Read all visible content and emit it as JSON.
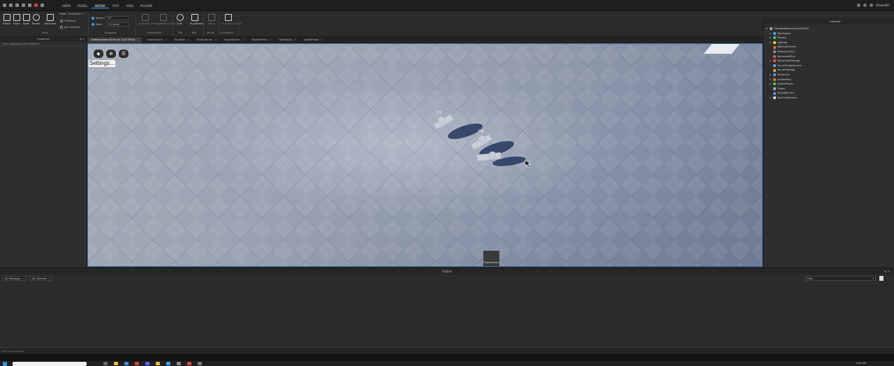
{
  "titlebar": {
    "menus": [
      "HOME",
      "MODEL",
      "AVATAR",
      "TEST",
      "VIEW",
      "PLUGINS"
    ],
    "active_menu": "AVATAR",
    "username": "ellowell07"
  },
  "ribbon": {
    "tools": [
      "Select",
      "Move",
      "Scale",
      "Rotate",
      "Transform"
    ],
    "mode_label": "Mode:",
    "mode_value": "Geometric",
    "collisions": "Collisions",
    "join_surfaces": "Join Surfaces",
    "rotate_label": "Rotate",
    "rotate_value": "15°",
    "move_label": "Move",
    "move_value": "0.2 studs",
    "group_tools": "Tools",
    "group_snapping": "Snapping",
    "accessories_tools": [
      "Accessory Fitting Tool",
      "Layered Clothing"
    ],
    "group_accessories": "Accessories",
    "rig_tools": [
      "Edit",
      "Rig Builder"
    ],
    "group_file": "File",
    "group_rig": "Rig",
    "setup_tool": "Setup",
    "group_setup": "Setup",
    "animation_tool": "Animation Editor",
    "group_animation": "Animation"
  },
  "left_panel": {
    "title": "Properties",
    "filter": "Filter Properties (Ctrl+Shift+P)"
  },
  "tabs": [
    {
      "label": "Untitled Game @ 09 Jun 2024 09:54",
      "active": true
    },
    {
      "label": "ControlClient",
      "active": false
    },
    {
      "label": "Shirtfam",
      "active": false
    },
    {
      "label": "PlayerServer",
      "active": false
    },
    {
      "label": "PlayerServer",
      "active": false
    },
    {
      "label": "PlayerPerma",
      "active": false
    },
    {
      "label": "TextStatus",
      "active": false
    },
    {
      "label": "LoadSample",
      "active": false
    }
  ],
  "viewport": {
    "settings_text": "Settings...",
    "rig_labels": [
      "Rig",
      "Rig"
    ],
    "plugin_thumb": "PlayerPerma"
  },
  "explorer": {
    "title": "Explorer",
    "items": [
      {
        "label": "ClimateAdventureUnlitiledV0",
        "color": "#9aa4b3",
        "arrow": "▾",
        "indent": 0
      },
      {
        "label": "Workspace",
        "color": "#4a9be0",
        "arrow": "▸",
        "indent": 1
      },
      {
        "label": "Players",
        "color": "#3fb86b",
        "arrow": "▸",
        "indent": 1
      },
      {
        "label": "Lighting",
        "color": "#e8c341",
        "arrow": "▸",
        "indent": 1
      },
      {
        "label": "MaterialService",
        "color": "#c8733a",
        "arrow": "",
        "indent": 1
      },
      {
        "label": "NetworkClient",
        "color": "#7d8fa6",
        "arrow": "",
        "indent": 1
      },
      {
        "label": "ReplicatedFirst",
        "color": "#d95b5b",
        "arrow": "",
        "indent": 1
      },
      {
        "label": "ReplicatedStorage",
        "color": "#d95b5b",
        "arrow": "▸",
        "indent": 1
      },
      {
        "label": "ServerScriptService",
        "color": "#58a6d6",
        "arrow": "",
        "indent": 1
      },
      {
        "label": "ServerStorage",
        "color": "#d99a3e",
        "arrow": "",
        "indent": 1
      },
      {
        "label": "StarterGui",
        "color": "#5b8fd9",
        "arrow": "▸",
        "indent": 1
      },
      {
        "label": "StarterPack",
        "color": "#c8733a",
        "arrow": "▸",
        "indent": 1
      },
      {
        "label": "StarterPlayer",
        "color": "#3fb86b",
        "arrow": "▸",
        "indent": 1
      },
      {
        "label": "Teams",
        "color": "#a6a6a6",
        "arrow": "",
        "indent": 1
      },
      {
        "label": "SoundService",
        "color": "#5b8fd9",
        "arrow": "",
        "indent": 1
      },
      {
        "label": "TextChatService",
        "color": "#d0d0d0",
        "arrow": "▸",
        "indent": 1
      }
    ]
  },
  "output": {
    "title": "Output",
    "messages_filter": "All Messages",
    "contexts_filter": "All Contexts",
    "search_placeholder": "Filter..."
  },
  "command_bar": {
    "placeholder": "Run a command"
  },
  "taskbar": {
    "time": "9:54 AM"
  }
}
